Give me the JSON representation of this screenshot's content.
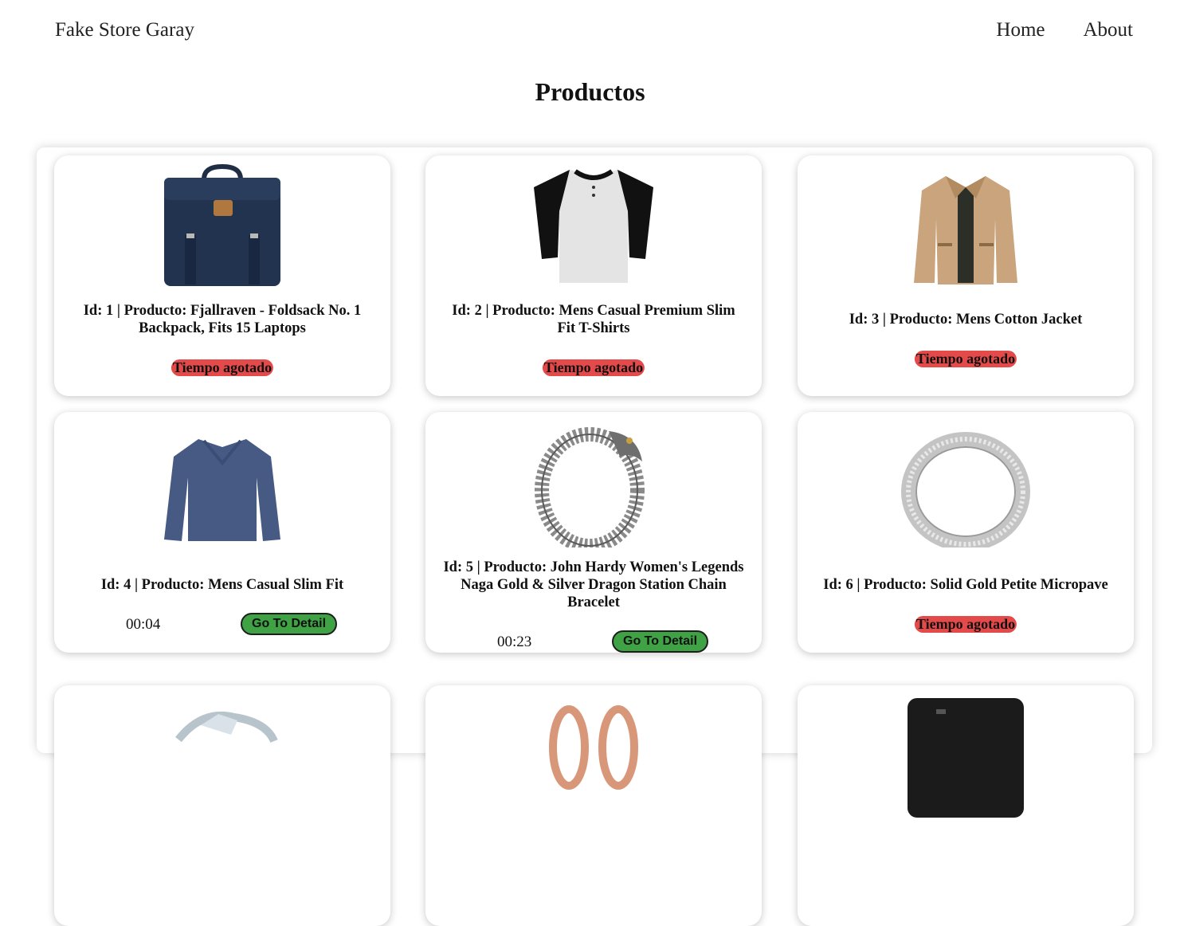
{
  "navbar": {
    "brand": "Fake Store Garay",
    "links": [
      "Home",
      "About"
    ]
  },
  "page": {
    "title": "Productos"
  },
  "products": [
    {
      "label": "Id: 1 | Producto: Fjallraven - Foldsack No. 1 Backpack, Fits 15 Laptops",
      "status": "Tiempo agotado",
      "image": "backpack-image"
    },
    {
      "label": "Id: 2 | Producto: Mens Casual Premium Slim Fit T-Shirts",
      "status": "Tiempo agotado",
      "image": "tshirt-image"
    },
    {
      "label": "Id: 3 | Producto: Mens Cotton Jacket",
      "status": "Tiempo agotado",
      "image": "jacket-image"
    },
    {
      "label": "Id: 4 | Producto: Mens Casual Slim Fit",
      "timer": "00:04",
      "button": "Go To Detail",
      "image": "longsleeve-image"
    },
    {
      "label": "Id: 5 | Producto: John Hardy Women's Legends Naga Gold & Silver Dragon Station Chain Bracelet",
      "timer": "00:23",
      "button": "Go To Detail",
      "image": "bracelet-image"
    },
    {
      "label": "Id: 6 | Producto: Solid Gold Petite Micropave",
      "status": "Tiempo agotado",
      "image": "ring-image"
    }
  ],
  "colors": {
    "expired_badge": "#e44a4a",
    "detail_button": "#3fa244"
  }
}
